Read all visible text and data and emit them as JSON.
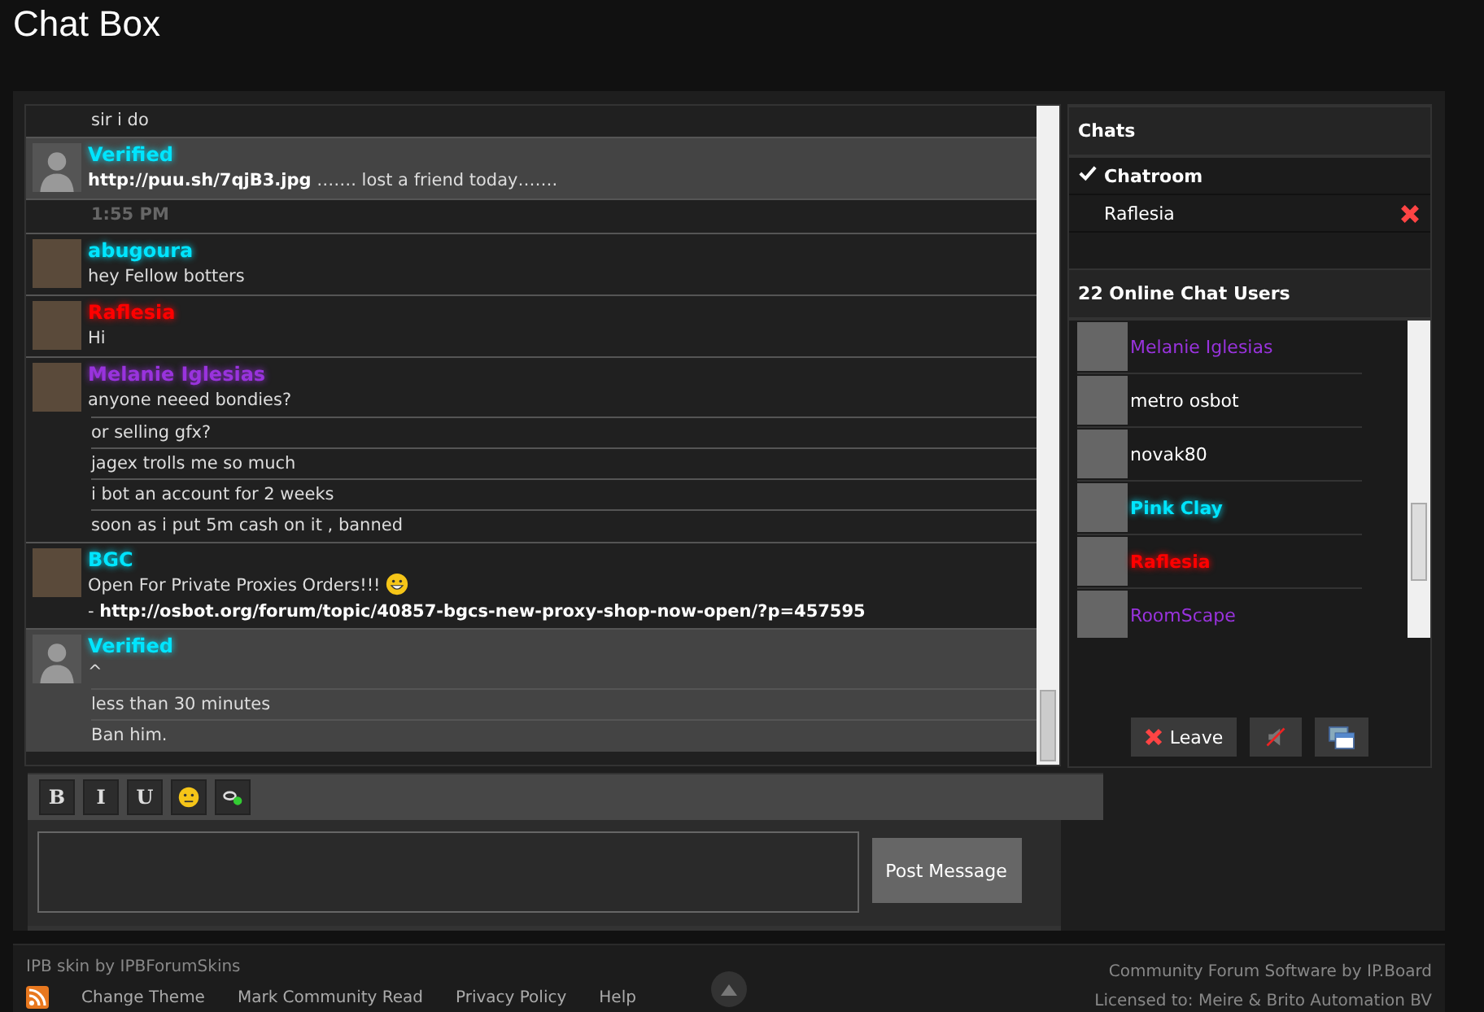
{
  "page_title": "Chat Box",
  "messages": [
    {
      "kind": "line",
      "highlighted": false,
      "text": "sir i do"
    },
    {
      "kind": "message",
      "highlighted": true,
      "avatar": {
        "kind": "silhouette"
      },
      "name": "Verified",
      "color": "#00e5ff",
      "text": "**http://puu.sh/7qjB3.jpg** ……. lost a friend today……."
    },
    {
      "kind": "time",
      "highlighted": false,
      "text": "1:55 PM"
    },
    {
      "kind": "message",
      "highlighted": false,
      "avatar": {
        "kind": "photo"
      },
      "name": "abugoura",
      "color": "#00e5ff",
      "text": "hey Fellow botters"
    },
    {
      "kind": "message",
      "highlighted": false,
      "avatar": {
        "kind": "photo"
      },
      "name": "Raflesia",
      "color": "#ff0000",
      "text": "Hi"
    },
    {
      "kind": "message",
      "highlighted": false,
      "avatar": {
        "kind": "photo"
      },
      "name": "Melanie Iglesias",
      "color": "#9933dd",
      "text": "anyone neeed bondies?"
    },
    {
      "kind": "line",
      "highlighted": false,
      "text": "or selling gfx?"
    },
    {
      "kind": "line",
      "highlighted": false,
      "text": "jagex trolls me so much"
    },
    {
      "kind": "line",
      "highlighted": false,
      "text": "i bot an account for 2 weeks"
    },
    {
      "kind": "line",
      "highlighted": false,
      "text": "soon as i put 5m cash on it , banned"
    },
    {
      "kind": "message",
      "highlighted": false,
      "avatar": {
        "kind": "photo"
      },
      "name": "BGC",
      "color": "#00e5ff",
      "text": "Open For Private Proxies Orders!!!",
      "emoji": true,
      "link": "- **http://osbot.org/forum/topic/40857-bgcs-new-proxy-shop-now-open/?p=457595**"
    },
    {
      "kind": "message",
      "highlighted": true,
      "avatar": {
        "kind": "silhouette"
      },
      "name": "Verified",
      "color": "#00e5ff",
      "text": "^"
    },
    {
      "kind": "line",
      "highlighted": true,
      "text": "less than 30 minutes"
    },
    {
      "kind": "line",
      "highlighted": true,
      "text": "Ban him."
    }
  ],
  "toolbar": [
    {
      "kind": "text",
      "label": "B"
    },
    {
      "kind": "text",
      "label": "I"
    },
    {
      "kind": "text",
      "label": "U"
    },
    {
      "kind": "emoticon"
    },
    {
      "kind": "link"
    }
  ],
  "post_button": "Post Message",
  "chats": {
    "title": "Chats",
    "items": [
      {
        "label": "Chatroom",
        "selected": true,
        "closable": false
      },
      {
        "label": "Raflesia",
        "selected": false,
        "closable": true
      }
    ]
  },
  "online": {
    "title": "22 Online Chat Users",
    "users": [
      {
        "name": "Melanie Iglesias",
        "color": "#9933dd",
        "bold": false
      },
      {
        "name": "metro osbot",
        "color": "#ffffff",
        "bold": false
      },
      {
        "name": "novak80",
        "color": "#ffffff",
        "bold": false
      },
      {
        "name": "Pink Clay",
        "color": "#00e5ff",
        "bold": true
      },
      {
        "name": "Raflesia",
        "color": "#ff0000",
        "bold": true
      },
      {
        "name": "RoomScape",
        "color": "#9933dd",
        "bold": false
      }
    ]
  },
  "leave_button": "Leave",
  "footer": {
    "skin_credit": "IPB skin by IPBForumSkins",
    "links": [
      "Change Theme",
      "Mark Community Read",
      "Privacy Policy",
      "Help"
    ],
    "software": "Community Forum Software by IP.Board",
    "license": "Licensed to: Meire & Brito Automation BV"
  }
}
